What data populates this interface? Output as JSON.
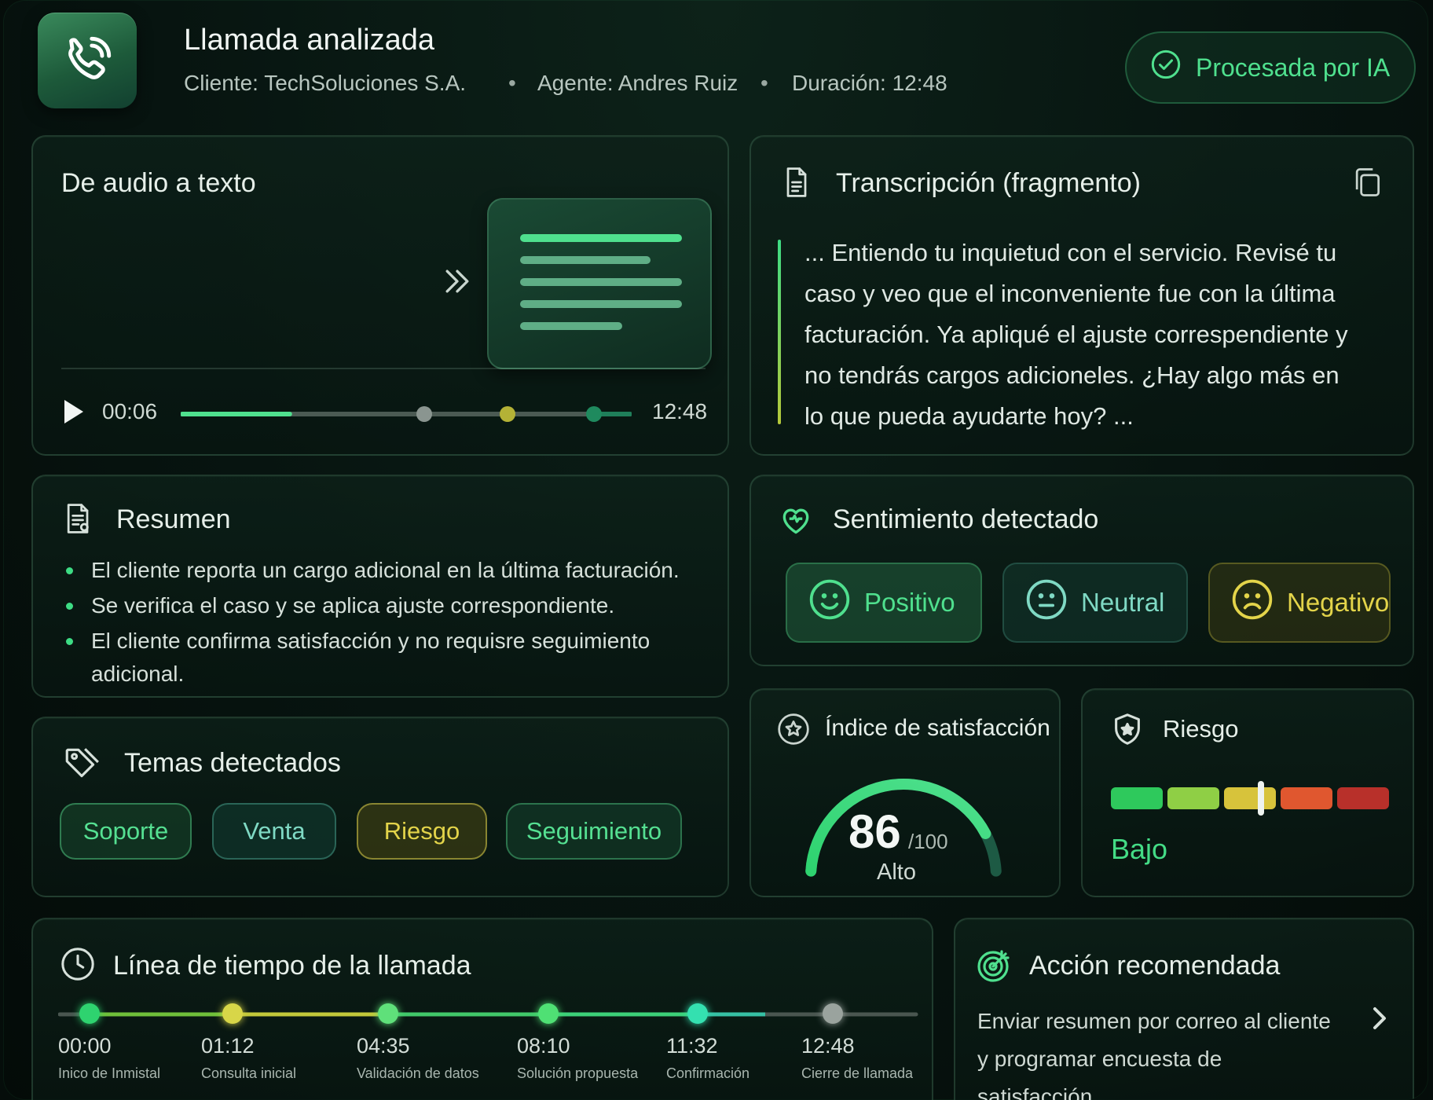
{
  "header": {
    "title": "Llamada analizada",
    "client": "Cliente: TechSoluciones S.A.",
    "agent": "Agente: Andres Ruiz",
    "duration": "Duración: 12:48",
    "separator": "•",
    "badge": "Procesada por IA"
  },
  "audio": {
    "title": "De audio a texto",
    "current_time": "00:06",
    "total_time": "12:48",
    "progress": 0.24
  },
  "transcript": {
    "title": "Transcripción (fragmento)",
    "text": "... Entiendo tu inquietud con el servicio. Revisé tu caso y veo que el inconveniente fue con la última facturación. Ya apliqué el ajuste correspendiente y no tendrás cargos adicioneles. ¿Hay algo más en lo que pueda ayudarte hoy? ..."
  },
  "summary": {
    "title": "Resumen",
    "items": [
      "El cliente reporta un cargo adicional en la última facturación.",
      "Se verifica el caso y se aplica ajuste correspondiente.",
      "El cliente confirma satisfacción y no requisre seguimiento adicional."
    ]
  },
  "sentiment": {
    "title": "Sentimiento detectado",
    "options": [
      "Positivo",
      "Neutral",
      "Negativo"
    ]
  },
  "topics": {
    "title": "Temas detectados",
    "tags": [
      "Soporte",
      "Venta",
      "Riesgo",
      "Seguimiento"
    ]
  },
  "satisfaction": {
    "title": "Índice de satisfacción",
    "score": "86",
    "max": "/100",
    "level": "Alto",
    "value": 86
  },
  "risk": {
    "title": "Riesgo",
    "level": "Bajo",
    "marker_fraction": 0.54,
    "colors": [
      "#2ec95c",
      "#8fcf45",
      "#d7c33b",
      "#e0572f",
      "#b8302a"
    ]
  },
  "timeline": {
    "title": "Línea de tiempo de la llamada",
    "events": [
      {
        "time": "00:00",
        "label": "Inico de Inmistal",
        "color": "#2ed36f"
      },
      {
        "time": "01:12",
        "label": "Consulta inicial",
        "color": "#d8d648"
      },
      {
        "time": "04:35",
        "label": "Validación de datos",
        "color": "#5fe07a"
      },
      {
        "time": "08:10",
        "label": "Solución propuesta",
        "color": "#4fe074"
      },
      {
        "time": "11:32",
        "label": "Confirmación",
        "color": "#34e0b0"
      },
      {
        "time": "12:48",
        "label": "Cierre de llamada",
        "color": "#9aa39e"
      }
    ]
  },
  "action": {
    "title": "Acción recomendada",
    "text": "Enviar resumen por correo al cliente y programar encuesta de satisfacción."
  }
}
